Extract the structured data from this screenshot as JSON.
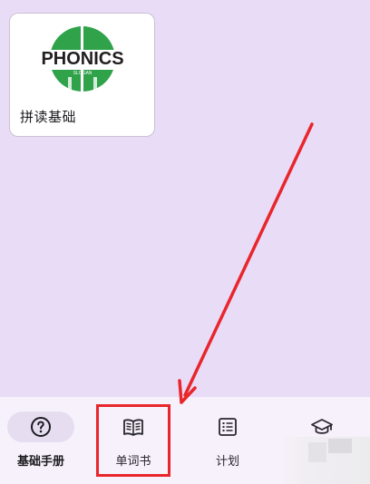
{
  "card": {
    "logo_text": "PHONICS",
    "logo_subtext": "SLOGAN",
    "label": "拼读基础"
  },
  "colors": {
    "background": "#e9dcf7",
    "nav_background": "#f6f1fa",
    "active_pill": "#e6ddf1",
    "logo_green": "#2fa24a",
    "annotation_red": "#e8262b"
  },
  "nav": {
    "items": [
      {
        "label": "基础手册",
        "icon": "help-circle-icon",
        "active": true
      },
      {
        "label": "单词书",
        "icon": "book-icon",
        "active": false
      },
      {
        "label": "计划",
        "icon": "list-icon",
        "active": false
      },
      {
        "label": "",
        "icon": "graduation-cap-icon",
        "active": false
      }
    ]
  }
}
